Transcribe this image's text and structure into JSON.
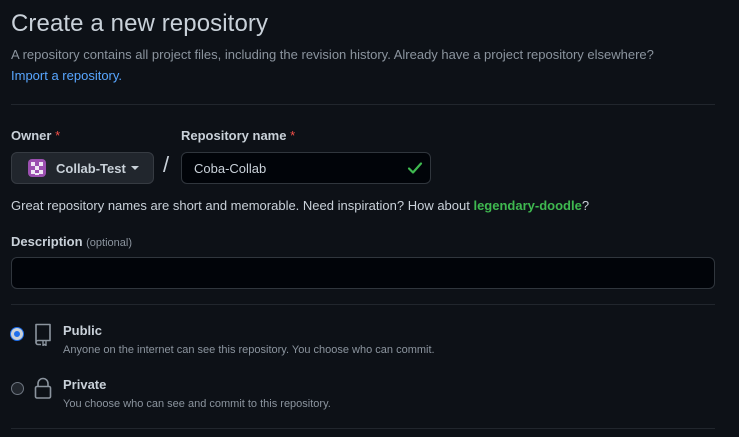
{
  "header": {
    "title": "Create a new repository",
    "subtitle": "A repository contains all project files, including the revision history. Already have a project repository elsewhere?",
    "import_link": "Import a repository."
  },
  "owner": {
    "label": "Owner",
    "required_mark": "*",
    "selected": "Collab-Test"
  },
  "separator": "/",
  "repository_name": {
    "label": "Repository name",
    "required_mark": "*",
    "value": "Coba-Collab",
    "valid_icon": "check-icon"
  },
  "name_hint": {
    "prefix": "Great repository names are short and memorable. Need inspiration? How about ",
    "suggestion": "legendary-doodle",
    "suffix": "?"
  },
  "description": {
    "label": "Description",
    "optional_note": "(optional)",
    "value": ""
  },
  "visibility": {
    "options": [
      {
        "title": "Public",
        "description": "Anyone on the internet can see this repository. You choose who can commit.",
        "icon": "repo-icon",
        "selected": true
      },
      {
        "title": "Private",
        "description": "You choose who can see and commit to this repository.",
        "icon": "lock-icon",
        "selected": false
      }
    ]
  },
  "colors": {
    "background": "#0d1117",
    "link": "#58a6ff",
    "success": "#3fb950",
    "required": "#f85149",
    "radio_selected": "#1f6feb"
  }
}
